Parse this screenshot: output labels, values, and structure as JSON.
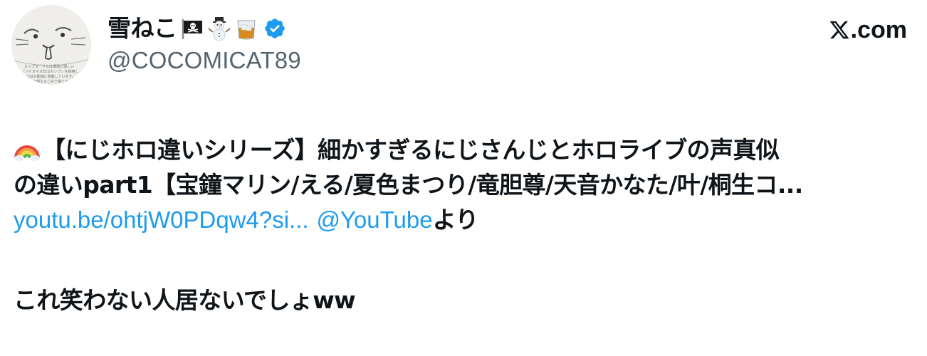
{
  "header": {
    "display_name": "雪ねこ",
    "name_emojis": [
      "pirate-flag-emoji",
      "snowman-emoji",
      "whisky-glass-emoji"
    ],
    "verified": true,
    "handle": "@COCOMICAT89",
    "brand": ".com",
    "avatar_caption_lines": [
      "カップヌードルは環境に優しい",
      "「バイオマスECOカップ」を採用し",
      "CO2の削減に貢献しています。",
      "フタは燃えるごみで捨ててください"
    ]
  },
  "tweet": {
    "line1": "【にじホロ違いシリーズ】細かすぎるにじさんじとホロライブの声真似",
    "line2": "の違いpart1【宝鐘マリン/える/夏色まつり/竜胆尊/天音かなた/叶/桐生コ...",
    "link_url": "youtu.be/ohtjW0PDqw4?si...",
    "link_mention": "@YouTube",
    "link_suffix": "より",
    "line4": "これ笑わない人居ないでしょww"
  },
  "colors": {
    "text": "#0f1419",
    "secondary": "#536471",
    "link": "#1d9bf0",
    "verified_badge": "#1d9bf0"
  }
}
